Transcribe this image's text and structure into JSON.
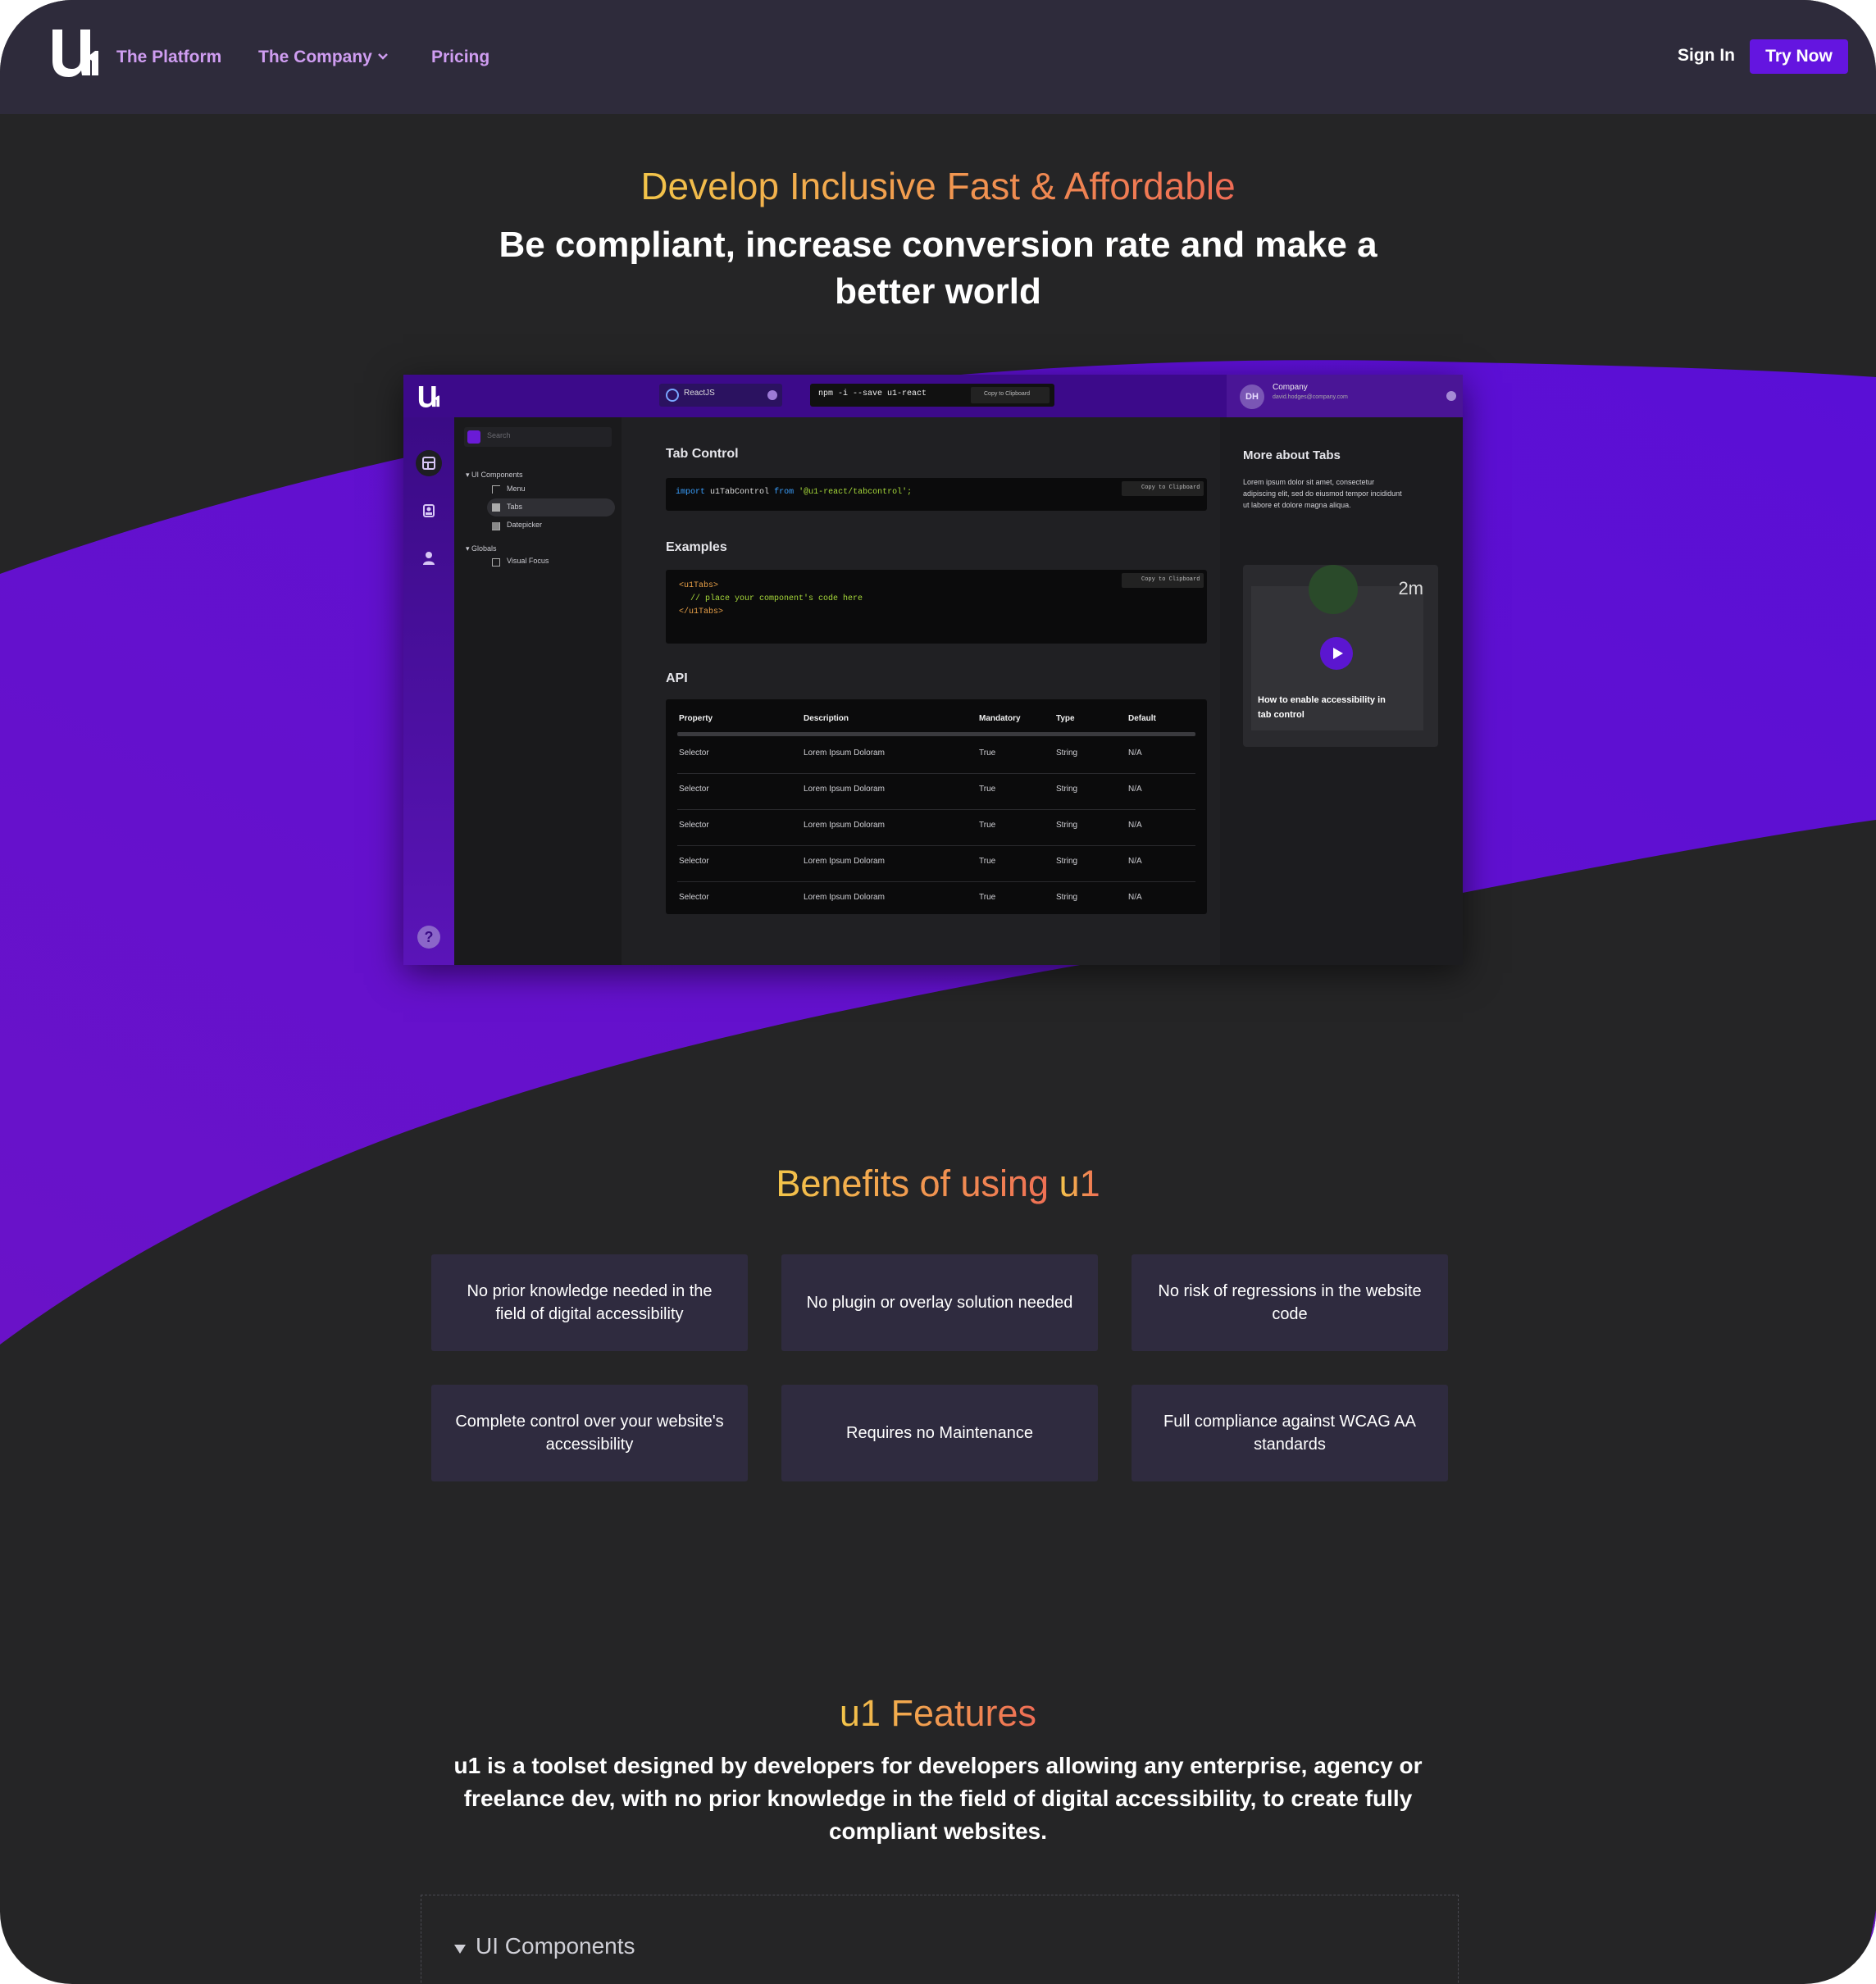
{
  "nav": {
    "links": [
      "The Platform",
      "The Company",
      "Pricing"
    ],
    "sign_in": "Sign In",
    "try_now": "Try Now",
    "logo": "u1-logo"
  },
  "hero": {
    "kicker": "Develop Inclusive Fast & Affordable",
    "title": "Be compliant, increase conversion rate and make a better world"
  },
  "app": {
    "search_placeholder": "Search",
    "tree": {
      "group1": "UI Components",
      "items1": [
        "Menu",
        "Tabs",
        "Datepicker"
      ],
      "group2": "Globals",
      "items2": [
        "Visual Focus"
      ]
    },
    "framework": "ReactJS",
    "install_cmd": "npm -i --save u1-react",
    "copy_label": "Copy to Clipboard",
    "user": {
      "initials": "DH",
      "company": "Company",
      "email": "david.hodges@company.com"
    },
    "tab_control": {
      "title": "Tab Control",
      "import_kw": "import",
      "import_name": "u1TabControl",
      "from_kw": "from",
      "import_path": "'@u1-react/tabcontrol';"
    },
    "examples": {
      "title": "Examples",
      "line1": "<u1Tabs>",
      "line2": "// place your component's code here",
      "line3": "</u1Tabs>"
    },
    "api": {
      "title": "API",
      "columns": [
        "Property",
        "Description",
        "Mandatory",
        "Type",
        "Default"
      ],
      "rows": [
        [
          "Selector",
          "Lorem Ipsum Doloram",
          "True",
          "String",
          "N/A"
        ],
        [
          "Selector",
          "Lorem Ipsum Doloram",
          "True",
          "String",
          "N/A"
        ],
        [
          "Selector",
          "Lorem Ipsum Doloram",
          "True",
          "String",
          "N/A"
        ],
        [
          "Selector",
          "Lorem Ipsum Doloram",
          "True",
          "String",
          "N/A"
        ],
        [
          "Selector",
          "Lorem Ipsum Doloram",
          "True",
          "String",
          "N/A"
        ]
      ]
    },
    "more": {
      "title": "More about Tabs",
      "text": "Lorem ipsum dolor sit amet, consectetur adipiscing elit, sed do eiusmod tempor incididunt ut labore et dolore magna aliqua.",
      "video_time": "2m",
      "video_caption": "How to enable accessibility in tab control"
    }
  },
  "benefits": {
    "title_prefix": "Benefits of using ",
    "title_brand": "u1",
    "cards": [
      "No prior knowledge needed in the field of digital accessibility",
      "No plugin or overlay solution needed",
      "No risk of regressions in the website code",
      "Complete control over your website's accessibility",
      "Requires no Maintenance",
      "Full compliance against WCAG AA standards"
    ]
  },
  "features": {
    "title": "u1 Features",
    "description": "u1 is a toolset designed by developers for developers allowing any enterprise, agency or freelance dev, with no prior knowledge in the field of digital accessibility, to create fully compliant websites.",
    "accordion_label": "UI Components"
  },
  "colors": {
    "background": "#252526",
    "nav": "#2e2b3b",
    "accent": "#6415e0",
    "wave": "#5a0fd0",
    "card": "#2f2b3f",
    "gradient_start": "#f3c54a",
    "gradient_end": "#ef6c55"
  }
}
